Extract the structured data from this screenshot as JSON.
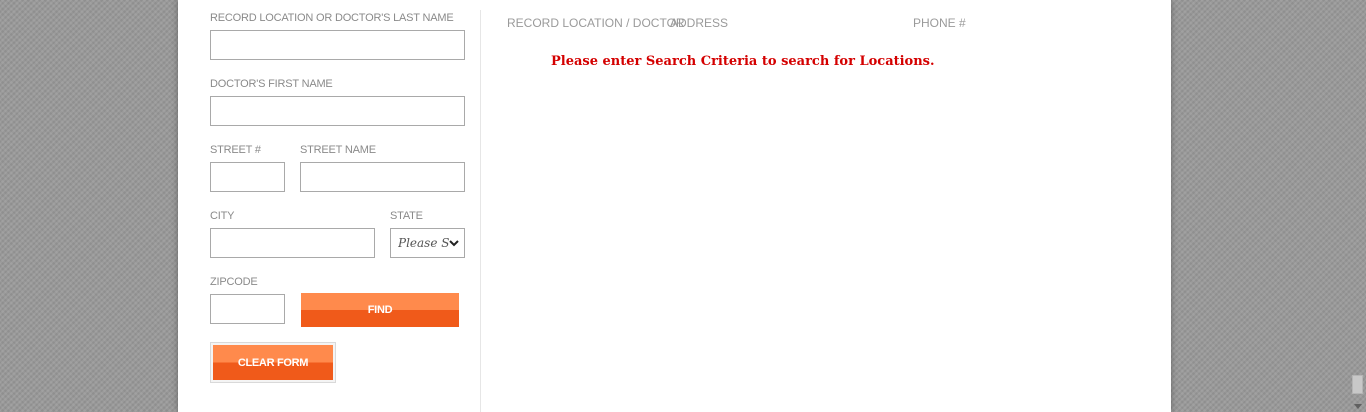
{
  "form": {
    "last_name_label": "RECORD LOCATION OR DOCTOR'S LAST NAME",
    "last_name_value": "",
    "first_name_label": "DOCTOR'S FIRST NAME",
    "first_name_value": "",
    "street_no_label": "STREET #",
    "street_no_value": "",
    "street_name_label": "STREET NAME",
    "street_name_value": "",
    "city_label": "CITY",
    "city_value": "",
    "state_label": "STATE",
    "state_selected": "Please Select",
    "zip_label": "ZIPCODE",
    "zip_value": "",
    "find_label": "FIND",
    "clear_label": "CLEAR FORM"
  },
  "results": {
    "columns": [
      "RECORD LOCATION / DOCTOR",
      "ADDRESS",
      "PHONE #"
    ],
    "message": "Please enter Search Criteria to search for Locations."
  },
  "colors": {
    "accent_top": "#ff8a4c",
    "accent_bottom": "#f05a1a",
    "message": "#d40000",
    "label": "#8a8a8a"
  },
  "icons": {
    "state_dropdown": "chevron-down-icon",
    "scroll_down": "arrow-down-icon"
  }
}
